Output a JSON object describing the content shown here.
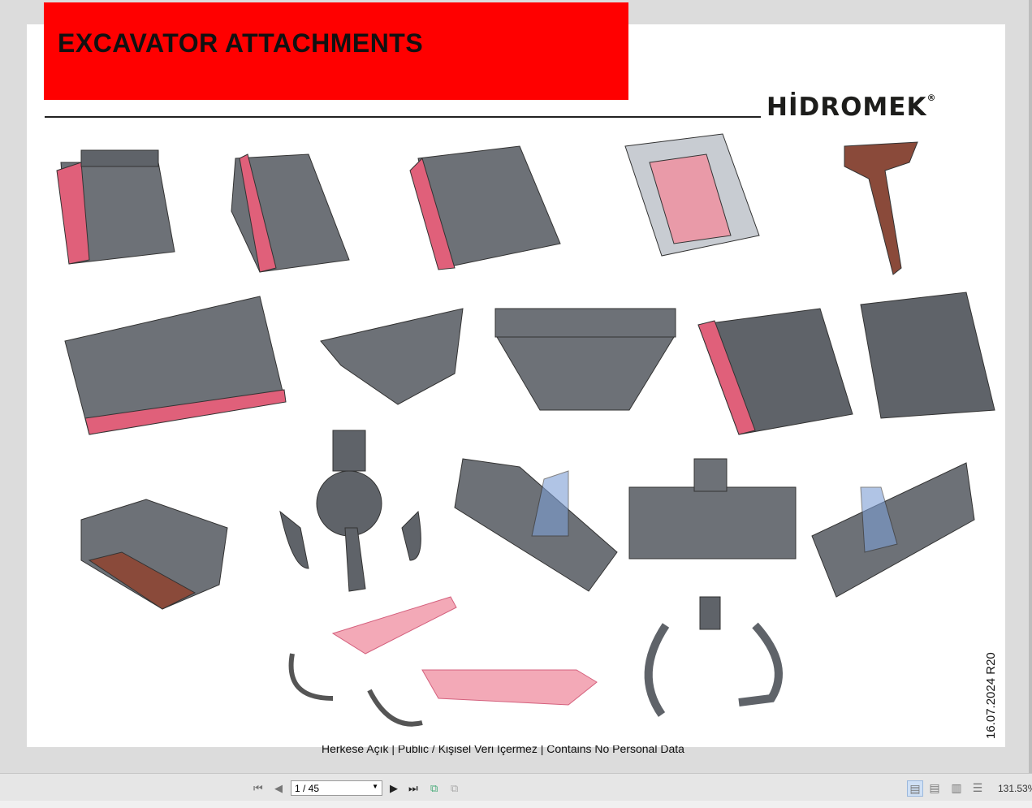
{
  "document": {
    "title": "EXCAVATOR ATTACHMENTS",
    "logo": "HİDROMEK",
    "logo_mark": "®",
    "date_revision": "16.07.2024 R20",
    "footer": "Herkese Açık | Public / Kişisel Veri İçermez | Contains No Personal Data"
  },
  "toolbar": {
    "page_value": "1 / 45",
    "zoom": "131.53%"
  },
  "colors": {
    "banner": "#ff0000",
    "attachment_gray": "#5f6369",
    "attachment_pink": "#e0607a"
  }
}
